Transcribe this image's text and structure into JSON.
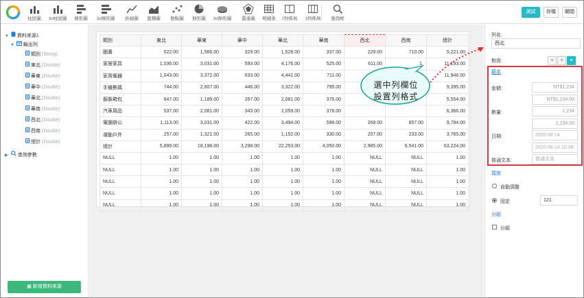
{
  "toolbar": {
    "items": [
      {
        "label": "柱狀圖",
        "icon": "bar-chart-icon"
      },
      {
        "label": "3d柱狀圖",
        "icon": "bar-3d-chart-icon"
      },
      {
        "label": "條形圖",
        "icon": "horizontal-bar-chart-icon"
      },
      {
        "label": "3d條形圖",
        "icon": "horizontal-bar-3d-chart-icon"
      },
      {
        "label": "折線圖",
        "icon": "line-chart-icon"
      },
      {
        "label": "面積圖",
        "icon": "area-chart-icon"
      },
      {
        "label": "散點圖",
        "icon": "scatter-chart-icon"
      },
      {
        "label": "餅形圖",
        "icon": "pie-chart-icon"
      },
      {
        "label": "3d餅形圖",
        "icon": "pie-3d-chart-icon"
      },
      {
        "label": "雷達圖",
        "icon": "radar-chart-icon"
      },
      {
        "label": "明細表",
        "icon": "detail-table-icon"
      },
      {
        "label": "2列佈局",
        "icon": "two-column-layout-icon"
      },
      {
        "label": "3列佈局",
        "icon": "three-column-layout-icon"
      },
      {
        "label": "查詢框",
        "icon": "search-icon"
      }
    ],
    "test_label": "測試",
    "save_label": "存檔",
    "close_label": "關閉"
  },
  "tree": {
    "datasource": "資料來源1",
    "output": "輸出列",
    "fields": [
      {
        "name": "類別",
        "type": "(String)"
      },
      {
        "name": "東北",
        "type": "(Double)"
      },
      {
        "name": "華東",
        "type": "(Double)"
      },
      {
        "name": "華中",
        "type": "(Double)"
      },
      {
        "name": "華北",
        "type": "(Double)"
      },
      {
        "name": "華南",
        "type": "(Double)"
      },
      {
        "name": "西北",
        "type": "(Double)"
      },
      {
        "name": "西南",
        "type": "(Double)"
      },
      {
        "name": "總計",
        "type": "(Double)"
      }
    ],
    "query_params": "查詢參數",
    "add_datasource": "新增資料來源"
  },
  "table": {
    "headers": [
      "類別",
      "東北",
      "華東",
      "華中",
      "華北",
      "華南",
      "西北",
      "西南",
      "總計"
    ],
    "selected_col": 6,
    "rows": [
      [
        "圖書",
        "522.00",
        "1,566.00",
        "329.00",
        "1,528.00",
        "337.00",
        "229.00",
        "710.00",
        "5,221.00"
      ],
      [
        "家居家具",
        "1,036.00",
        "3,031.00",
        "593.00",
        "4,176.00",
        "525.00",
        "611.00",
        "1,",
        "11,193.00"
      ],
      [
        "家用電器",
        "1,043.00",
        "3,372.00",
        "633.00",
        "4,441.00",
        "711.00",
        "",
        "",
        "11,946.00"
      ],
      [
        "手機數碼",
        "744.00",
        "2,607.00",
        "446.00",
        "3,322.00",
        "795.00",
        "",
        "",
        "9,395.00"
      ],
      [
        "服裝箱包",
        "647.00",
        "1,189.00",
        "267.00",
        "2,081.00",
        "376.00",
        "",
        "",
        "5,554.00"
      ],
      [
        "汽車用品",
        "537.00",
        "2,081.00",
        "343.00",
        "2,059.00",
        "378.00",
        "",
        "",
        "6,366.00"
      ],
      [
        "電腦辦公",
        "1,113.00",
        "3,031.00",
        "422.00",
        "3,494.00",
        "598.00",
        "269.00",
        "857.00",
        "9,784.00"
      ],
      [
        "運動戶外",
        "257.00",
        "1,321.00",
        "265.00",
        "1,152.00",
        "330.00",
        "207.00",
        "233.00",
        "3,765.00"
      ],
      [
        "總計",
        "5,899.00",
        "18,198.00",
        "3,298.00",
        "22,253.00",
        "4,050.00",
        "2,985.00",
        "6,541.00",
        "63,224.00"
      ],
      [
        "NULL",
        "1.00",
        "1.00",
        "1.00",
        "1.00",
        "1.00",
        "NULL",
        "NULL",
        "1.00"
      ],
      [
        "NULL",
        "1.00",
        "1.00",
        "1.00",
        "1.00",
        "1.00",
        "NULL",
        "NULL",
        "1.00"
      ],
      [
        "NULL",
        "1.00",
        "1.00",
        "1.00",
        "1.00",
        "1.00",
        "NULL",
        "NULL",
        "1.00"
      ],
      [
        "NULL",
        "1.00",
        "1.00",
        "1.00",
        "1.00",
        "1.00",
        "NULL",
        "NULL",
        "1.00"
      ],
      [
        "NULL",
        "1.00",
        "1.00",
        "1.00",
        "1.00",
        "1.00",
        "NULL",
        "NULL",
        "1.00"
      ]
    ]
  },
  "callout": {
    "line1": "選中列欄位",
    "line2": "設置列格式"
  },
  "props": {
    "colname_label": "列名:",
    "colname_value": "西北",
    "align_label": "對齊:",
    "format_title": "範本",
    "amount_label": "金額:",
    "amount_1": "NT$1,234",
    "amount_2": "NT$1,234.00",
    "number_label": "數量:",
    "number_1": "1,234",
    "number_2": "1,234.00",
    "date_label": "日期:",
    "date_1": "2020-08-14",
    "date_2": "2020-08-14 10:38",
    "text_label": "普通文本:",
    "text_placeholder": "普通文本",
    "width_title": "寬度",
    "auto_label": "自動調整",
    "fixed_label": "固定",
    "fixed_value": "121",
    "group_title": "分組",
    "group_label": "分組"
  },
  "colors": {
    "accent": "#26b9c8",
    "highlight": "#d9363e",
    "add_button": "#3cb97a"
  }
}
